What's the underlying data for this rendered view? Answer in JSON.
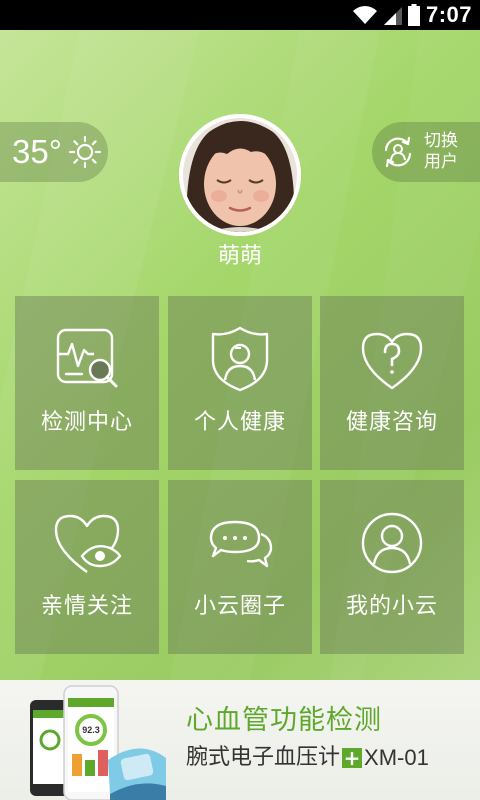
{
  "status_bar": {
    "time": "7:07",
    "icons": [
      "wifi-icon",
      "signal-icon",
      "battery-icon"
    ]
  },
  "weather": {
    "temperature": "35°",
    "icon": "sun-icon"
  },
  "switch_user": {
    "line1": "切换",
    "line2": "用户",
    "icon": "switch-user-icon"
  },
  "profile": {
    "name": "萌萌"
  },
  "tiles": [
    {
      "label": "检测中心",
      "icon": "monitor-search-icon"
    },
    {
      "label": "个人健康",
      "icon": "shield-user-icon"
    },
    {
      "label": "健康咨询",
      "icon": "heart-question-icon"
    },
    {
      "label": "亲情关注",
      "icon": "heart-eye-icon"
    },
    {
      "label": "小云圈子",
      "icon": "chat-bubbles-icon"
    },
    {
      "label": "我的小云",
      "icon": "user-circle-icon"
    }
  ],
  "banner": {
    "title": "心血管功能检测",
    "subtitle": "腕式电子血压计",
    "plus": "+",
    "model": "XM-01",
    "phone_reading": "92.3"
  },
  "colors": {
    "accent_green": "#5ea82c",
    "background_green": "#a4d66a",
    "tile_overlay": "rgba(105,120,85,0.45)"
  }
}
